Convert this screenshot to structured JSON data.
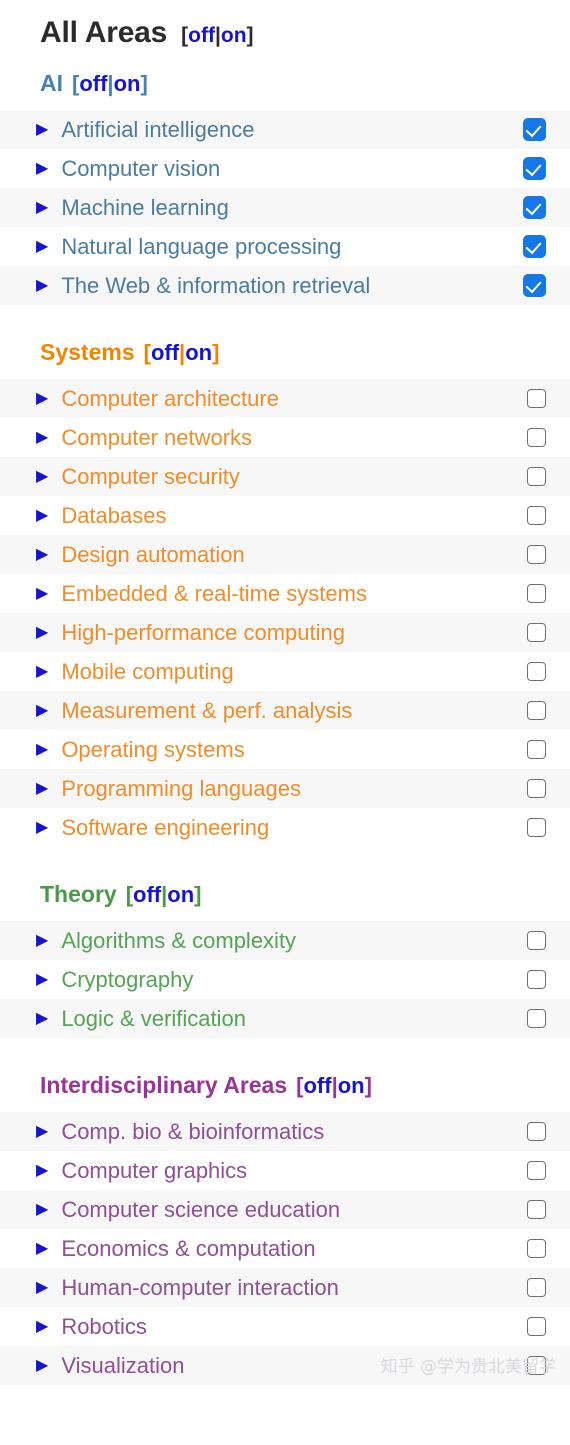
{
  "colors": {
    "ai": "#4682b4",
    "systems": "#f28500",
    "theory": "#4a9a4a",
    "interdisciplinary": "#993399",
    "toggle_link": "#1414d2",
    "triangle": "#1414d2",
    "checkbox_checked": "#1677e8",
    "row_stripe": "#f7f7f8",
    "title": "#2b2b2b"
  },
  "master": {
    "title": "All Areas",
    "toggle": {
      "open_bracket": "[",
      "off_label": "off",
      "separator": "|",
      "on_label": "on",
      "close_bracket": "]"
    }
  },
  "toggle": {
    "open_bracket": "[",
    "off_label": "off",
    "separator": "|",
    "on_label": "on",
    "close_bracket": "]"
  },
  "sections": [
    {
      "name": "AI",
      "theme": "sec-ai",
      "rows": [
        {
          "label": "Artificial intelligence",
          "checked": true,
          "expander": "▶"
        },
        {
          "label": "Computer vision",
          "checked": true,
          "expander": "▶"
        },
        {
          "label": "Machine learning",
          "checked": true,
          "expander": "▶"
        },
        {
          "label": "Natural language processing",
          "checked": true,
          "expander": "▶"
        },
        {
          "label": "The Web & information retrieval",
          "checked": true,
          "expander": "▶"
        }
      ]
    },
    {
      "name": "Systems",
      "theme": "sec-sys",
      "rows": [
        {
          "label": "Computer architecture",
          "checked": false,
          "expander": "▶"
        },
        {
          "label": "Computer networks",
          "checked": false,
          "expander": "▶"
        },
        {
          "label": "Computer security",
          "checked": false,
          "expander": "▶"
        },
        {
          "label": "Databases",
          "checked": false,
          "expander": "▶"
        },
        {
          "label": "Design automation",
          "checked": false,
          "expander": "▶"
        },
        {
          "label": "Embedded & real-time systems",
          "checked": false,
          "expander": "▶"
        },
        {
          "label": "High-performance computing",
          "checked": false,
          "expander": "▶"
        },
        {
          "label": "Mobile computing",
          "checked": false,
          "expander": "▶"
        },
        {
          "label": "Measurement & perf. analysis",
          "checked": false,
          "expander": "▶"
        },
        {
          "label": "Operating systems",
          "checked": false,
          "expander": "▶"
        },
        {
          "label": "Programming languages",
          "checked": false,
          "expander": "▶"
        },
        {
          "label": "Software engineering",
          "checked": false,
          "expander": "▶"
        }
      ]
    },
    {
      "name": "Theory",
      "theme": "sec-theory",
      "rows": [
        {
          "label": "Algorithms & complexity",
          "checked": false,
          "expander": "▶"
        },
        {
          "label": "Cryptography",
          "checked": false,
          "expander": "▶"
        },
        {
          "label": "Logic & verification",
          "checked": false,
          "expander": "▶"
        }
      ]
    },
    {
      "name": "Interdisciplinary Areas",
      "theme": "sec-inter",
      "rows": [
        {
          "label": "Comp. bio & bioinformatics",
          "checked": false,
          "expander": "▶"
        },
        {
          "label": "Computer graphics",
          "checked": false,
          "expander": "▶"
        },
        {
          "label": "Computer science education",
          "checked": false,
          "expander": "▶"
        },
        {
          "label": "Economics & computation",
          "checked": false,
          "expander": "▶"
        },
        {
          "label": "Human-computer interaction",
          "checked": false,
          "expander": "▶"
        },
        {
          "label": "Robotics",
          "checked": false,
          "expander": "▶"
        },
        {
          "label": "Visualization",
          "checked": false,
          "expander": "▶"
        }
      ]
    }
  ],
  "watermark": {
    "text": "知乎 @学为贵北美留学"
  }
}
